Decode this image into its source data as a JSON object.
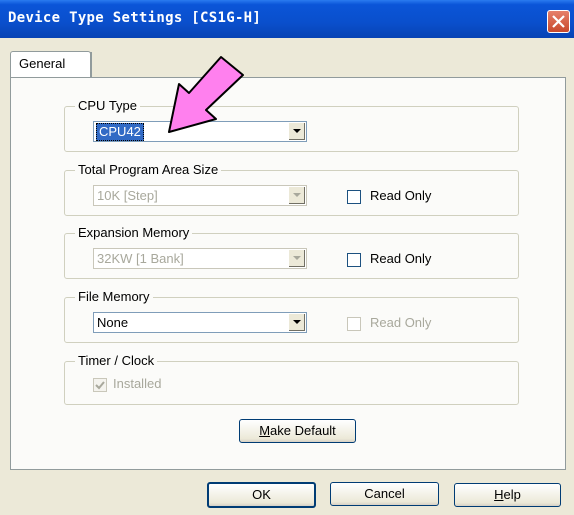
{
  "window": {
    "title": "Device Type Settings [CS1G-H]"
  },
  "tabs": [
    {
      "label": "General"
    }
  ],
  "cpu_type": {
    "label": "CPU Type",
    "value": "CPU42"
  },
  "program_area": {
    "label": "Total Program Area Size",
    "value": "10K [Step]",
    "read_only_label": "Read Only"
  },
  "expansion_memory": {
    "label": "Expansion Memory",
    "value": "32KW [1 Bank]",
    "read_only_label": "Read Only"
  },
  "file_memory": {
    "label": "File Memory",
    "value": "None",
    "read_only_label": "Read Only"
  },
  "timer_clock": {
    "label": "Timer / Clock",
    "installed_label": "Installed",
    "installed_checked": true
  },
  "buttons": {
    "make_default_accel": "M",
    "make_default_rest": "ake Default",
    "ok": "OK",
    "cancel": "Cancel",
    "help_accel": "H",
    "help_rest": "elp"
  },
  "colors": {
    "title_bar": "#0a4fcc",
    "selection": "#316ac5",
    "annotation_arrow": "#ff80ee"
  }
}
